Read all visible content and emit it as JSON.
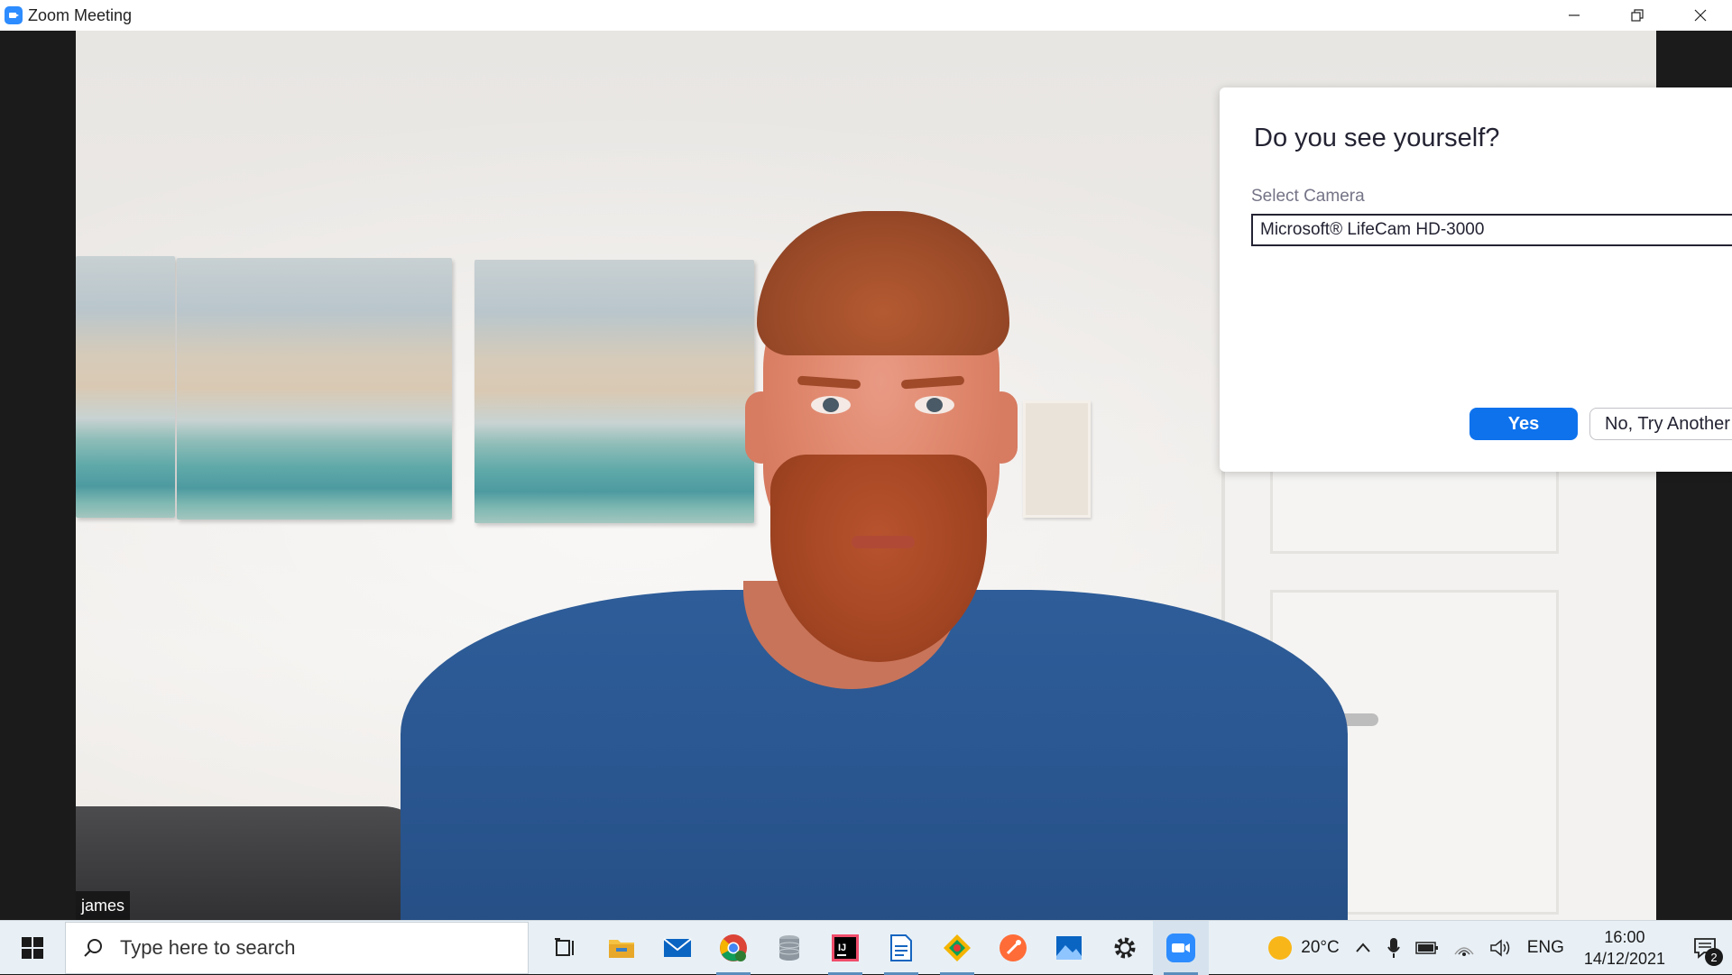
{
  "window": {
    "title": "Zoom Meeting",
    "minimize_glyph": "─",
    "restore_glyph": "❐",
    "close_glyph": "✕"
  },
  "video": {
    "participant_name": "james"
  },
  "dialog": {
    "title": "Do you see yourself?",
    "select_label": "Select Camera",
    "selected_camera": "Microsoft® LifeCam HD-3000",
    "yes_label": "Yes",
    "try_another_label": "No, Try Another"
  },
  "taskbar": {
    "search_placeholder": "Type here to search",
    "apps": [
      {
        "name": "task-view",
        "icon": "task-view-icon"
      },
      {
        "name": "file-explorer",
        "icon": "folder-icon"
      },
      {
        "name": "mail",
        "icon": "mail-icon"
      },
      {
        "name": "chrome",
        "icon": "chrome-icon"
      },
      {
        "name": "database",
        "icon": "database-icon"
      },
      {
        "name": "intellij",
        "icon": "intellij-icon"
      },
      {
        "name": "notepad",
        "icon": "document-icon"
      },
      {
        "name": "git",
        "icon": "git-icon"
      },
      {
        "name": "postman",
        "icon": "postman-icon"
      },
      {
        "name": "photos",
        "icon": "photos-icon"
      },
      {
        "name": "settings",
        "icon": "gear-icon"
      },
      {
        "name": "zoom",
        "icon": "zoom-icon"
      }
    ],
    "weather_temp": "20°C",
    "language": "ENG",
    "time": "16:00",
    "date": "14/12/2021",
    "notification_count": "2"
  },
  "colors": {
    "zoom_blue": "#0e72ed",
    "taskbar_bg": "#e8f0f6"
  }
}
